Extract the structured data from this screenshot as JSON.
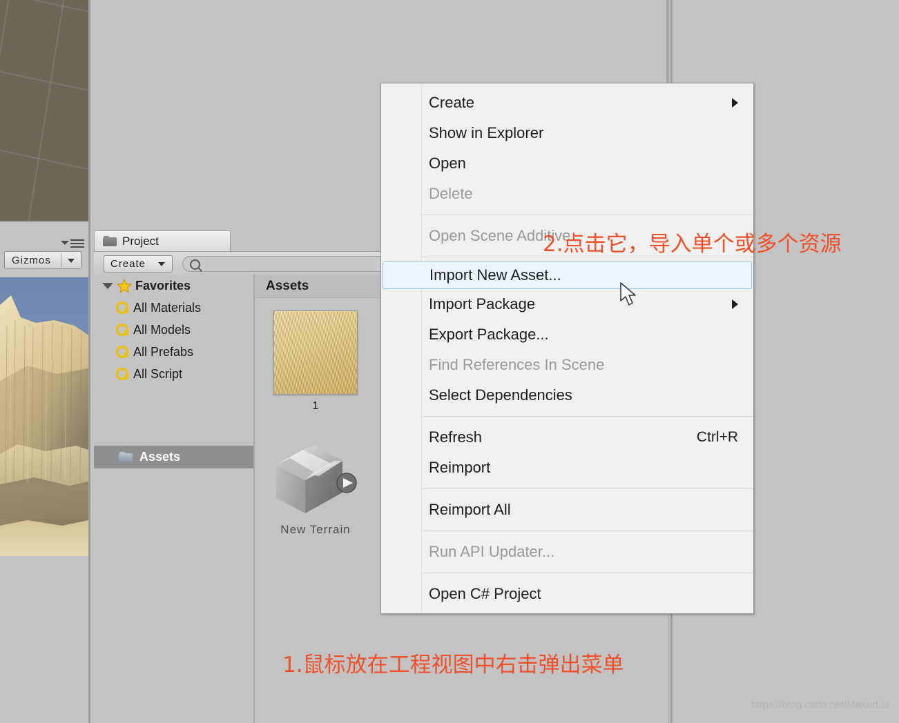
{
  "app": {
    "name": "Unity Editor",
    "watermark": "https://blog.csdn.net/MakerLiu"
  },
  "scene_view": {
    "name": "scene-view",
    "background_color": "#6e6659"
  },
  "gizmos_bar": {
    "button_label": "Gizmos",
    "menu_icon": "hamburger-icon",
    "dropdown_icon": "chevron-down-icon"
  },
  "project_panel": {
    "tab_label": "Project",
    "tab_icon": "folder-icon",
    "toolbar": {
      "create_label": "Create",
      "create_caret": "chevron-down-icon",
      "search_placeholder": "",
      "search_value": "",
      "search_icon": "search-icon"
    },
    "tree": {
      "favorites_label": "Favorites",
      "favorites_icon": "star-icon",
      "disclosure_icon": "triangle-down-icon",
      "items": [
        {
          "label": "All Materials",
          "icon": "search-icon"
        },
        {
          "label": "All Models",
          "icon": "search-icon"
        },
        {
          "label": "All Prefabs",
          "icon": "search-icon"
        },
        {
          "label": "All Script",
          "icon": "search-icon"
        }
      ],
      "assets_label": "Assets",
      "assets_icon": "folder-icon"
    },
    "grid": {
      "header_label": "Assets",
      "items": [
        {
          "label": "1",
          "icon": "sand-texture-thumbnail"
        },
        {
          "label": "New Terrain",
          "icon": "package-box-icon"
        }
      ]
    }
  },
  "context_menu": {
    "groups": [
      {
        "items": [
          {
            "label": "Create",
            "enabled": true,
            "submenu": true,
            "shortcut": ""
          },
          {
            "label": "Show in Explorer",
            "enabled": true,
            "submenu": false,
            "shortcut": ""
          },
          {
            "label": "Open",
            "enabled": true,
            "submenu": false,
            "shortcut": ""
          },
          {
            "label": "Delete",
            "enabled": false,
            "submenu": false,
            "shortcut": ""
          }
        ]
      },
      {
        "items": [
          {
            "label": "Open Scene Additive",
            "enabled": false,
            "submenu": false,
            "shortcut": ""
          }
        ]
      },
      {
        "items": [
          {
            "label": "Import New Asset...",
            "enabled": true,
            "submenu": false,
            "shortcut": "",
            "selected": true
          },
          {
            "label": "Import Package",
            "enabled": true,
            "submenu": true,
            "shortcut": ""
          },
          {
            "label": "Export Package...",
            "enabled": true,
            "submenu": false,
            "shortcut": ""
          },
          {
            "label": "Find References In Scene",
            "enabled": false,
            "submenu": false,
            "shortcut": ""
          },
          {
            "label": "Select Dependencies",
            "enabled": true,
            "submenu": false,
            "shortcut": ""
          }
        ]
      },
      {
        "items": [
          {
            "label": "Refresh",
            "enabled": true,
            "submenu": false,
            "shortcut": "Ctrl+R"
          },
          {
            "label": "Reimport",
            "enabled": true,
            "submenu": false,
            "shortcut": ""
          }
        ]
      },
      {
        "items": [
          {
            "label": "Reimport All",
            "enabled": true,
            "submenu": false,
            "shortcut": ""
          }
        ]
      },
      {
        "items": [
          {
            "label": "Run API Updater...",
            "enabled": false,
            "submenu": false,
            "shortcut": ""
          }
        ]
      },
      {
        "items": [
          {
            "label": "Open C# Project",
            "enabled": true,
            "submenu": false,
            "shortcut": ""
          }
        ]
      }
    ]
  },
  "annotations": {
    "step1": "1.鼠标放在工程视图中右击弹出菜单",
    "step2": "2.点击它，导入单个或多个资源",
    "color": "#f0502a"
  },
  "colors": {
    "editor_background": "#c3c3c3",
    "menu_background": "#f0f0f0",
    "menu_selected_fill": "#ebf4fd",
    "menu_selected_border": "#9fc6e8",
    "disabled_text": "#9a9a9a",
    "splitter": "#9a9a9a",
    "tree_selection": "#8f8f8f"
  }
}
